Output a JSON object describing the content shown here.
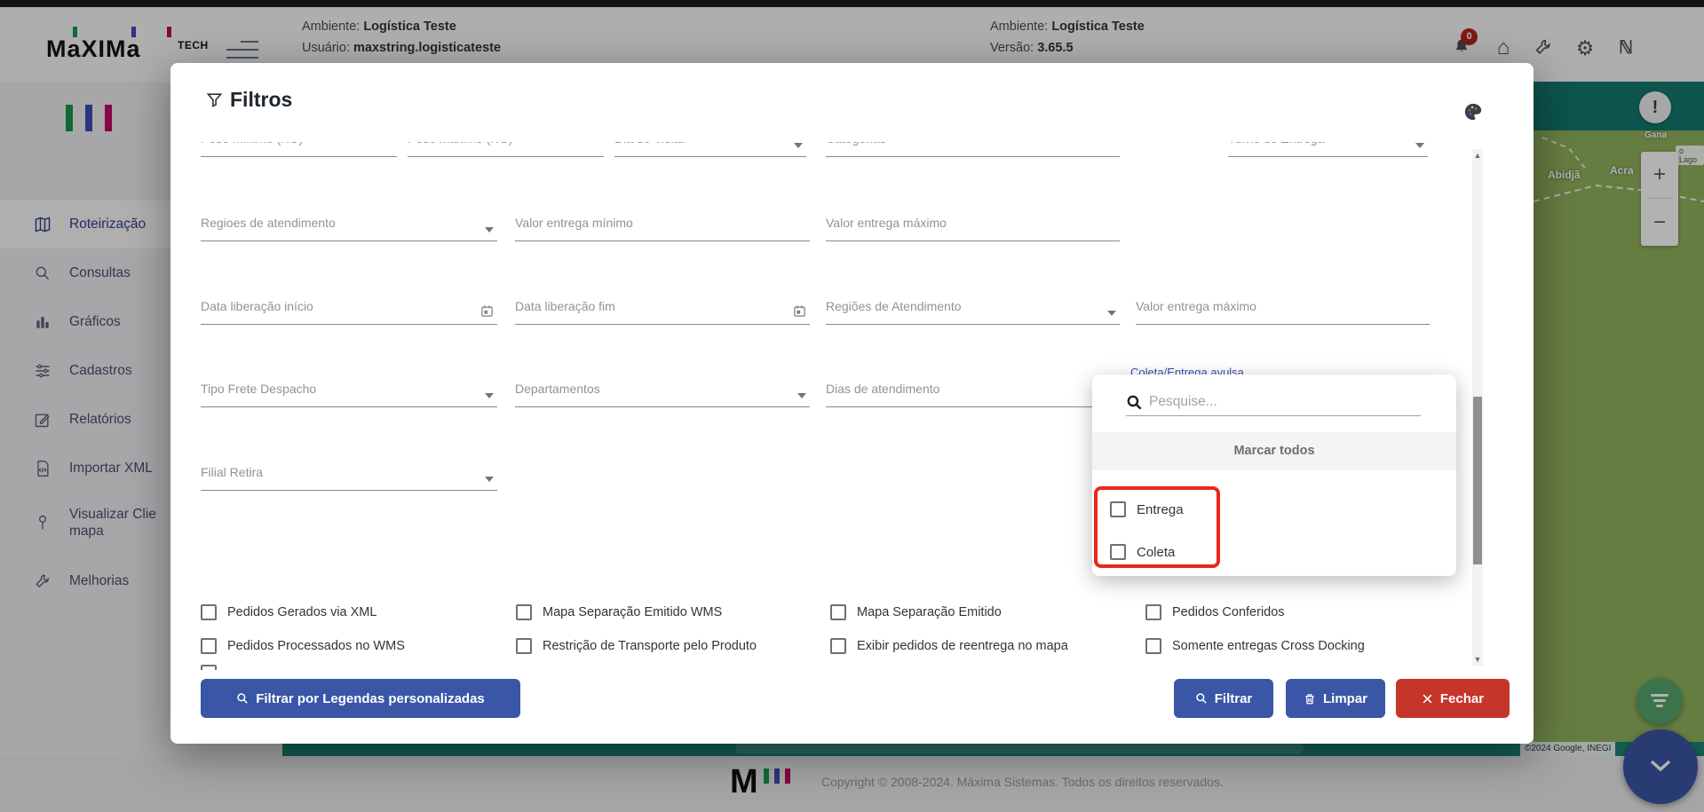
{
  "header": {
    "brand_text": "MaXIMa",
    "brand_suffix": "TECH",
    "env1_label": "Ambiente:",
    "env1_value": "Logística Teste",
    "user_label": "Usuário:",
    "user_value": "maxstring.logisticateste",
    "env2_label": "Ambiente:",
    "env2_value": "Logística Teste",
    "version_label": "Versão:",
    "version_value": "3.65.5",
    "notification_count": "0",
    "icons": [
      "bell-icon",
      "home-icon",
      "wrench-icon",
      "gear-icon",
      "brand-n-icon"
    ]
  },
  "sidebar": {
    "items": [
      {
        "label": "Roteirização",
        "icon": "map-icon",
        "active": true
      },
      {
        "label": "Consultas",
        "icon": "search-icon"
      },
      {
        "label": "Gráficos",
        "icon": "bar-chart-icon"
      },
      {
        "label": "Cadastros",
        "icon": "sliders-icon"
      },
      {
        "label": "Relatórios",
        "icon": "edit-icon"
      },
      {
        "label": "Importar XML",
        "icon": "xml-file-icon"
      },
      {
        "label": "Visualizar Clie",
        "label_line2": "mapa",
        "icon": "pin-icon"
      },
      {
        "label": "Melhorias",
        "icon": "wrench-icon"
      }
    ]
  },
  "modal": {
    "title": "Filtros",
    "fields": [
      {
        "label": "Peso mínimo (KG)"
      },
      {
        "label": "Peso máximo (KG)"
      },
      {
        "label": "Dia de Visita"
      },
      {
        "label": "Categorias"
      },
      {
        "label": "Turno de Entrega"
      },
      {
        "label": "Regioes de atendimento"
      },
      {
        "label": "Valor entrega mínimo"
      },
      {
        "label": "Valor entrega máximo"
      },
      {
        "label": "Data liberação início"
      },
      {
        "label": "Data liberação fim"
      },
      {
        "label": "Regiões de Atendimento"
      },
      {
        "label": "Valor entrega máximo"
      },
      {
        "label": "Tipo Frete Despacho"
      },
      {
        "label": "Departamentos"
      },
      {
        "label": "Dias de atendimento"
      },
      {
        "label": "Filial Retira"
      }
    ],
    "focused_field_label": "Coleta/Entrega avulsa",
    "checkboxes": [
      "Pedidos Gerados via XML",
      "Mapa Separação Emitido WMS",
      "Mapa Separação Emitido",
      "Pedidos Conferidos",
      "Pedidos Processados no WMS",
      "Restrição de Transporte pelo Produto",
      "Exibir pedidos de reentrega no mapa",
      "Somente entregas Cross Docking"
    ],
    "legend_button": "Filtrar por Legendas personalizadas",
    "filter_button": "Filtrar",
    "clear_button": "Limpar",
    "close_button": "Fechar",
    "popup": {
      "search_placeholder": "Pesquise...",
      "select_all": "Marcar todos",
      "options": [
        "Entrega",
        "Coleta"
      ]
    }
  },
  "map": {
    "region_label": "Gana",
    "chip_label": "o Lago",
    "city1": "Abidjã",
    "city2": "Acra",
    "zoom_in": "+",
    "zoom_out": "−",
    "alert": "!",
    "attribution": "©2024 Google, INEGI"
  },
  "footer": {
    "logo_letter": "M",
    "copyright": "Copyright © 2008-2024. Máxima Sistemas. Todos os direitos reservados."
  },
  "colors": {
    "accent_blue": "#3a57a7",
    "danger_red": "#c53529",
    "highlight_red": "#e8291c",
    "brand_green": "#17984b",
    "brand_indigo": "#3d4db7",
    "brand_magenta": "#c00862",
    "map_green": "#92b45e",
    "teal": "#12796d"
  }
}
